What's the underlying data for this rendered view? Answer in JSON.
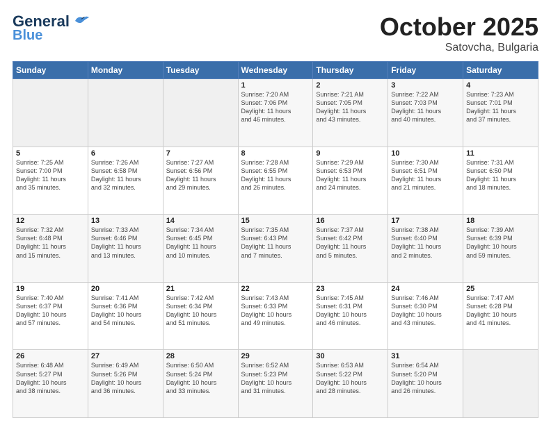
{
  "header": {
    "logo_line1": "General",
    "logo_line2": "Blue",
    "month": "October 2025",
    "location": "Satovcha, Bulgaria"
  },
  "weekdays": [
    "Sunday",
    "Monday",
    "Tuesday",
    "Wednesday",
    "Thursday",
    "Friday",
    "Saturday"
  ],
  "weeks": [
    [
      {
        "day": "",
        "info": ""
      },
      {
        "day": "",
        "info": ""
      },
      {
        "day": "",
        "info": ""
      },
      {
        "day": "1",
        "info": "Sunrise: 7:20 AM\nSunset: 7:06 PM\nDaylight: 11 hours\nand 46 minutes."
      },
      {
        "day": "2",
        "info": "Sunrise: 7:21 AM\nSunset: 7:05 PM\nDaylight: 11 hours\nand 43 minutes."
      },
      {
        "day": "3",
        "info": "Sunrise: 7:22 AM\nSunset: 7:03 PM\nDaylight: 11 hours\nand 40 minutes."
      },
      {
        "day": "4",
        "info": "Sunrise: 7:23 AM\nSunset: 7:01 PM\nDaylight: 11 hours\nand 37 minutes."
      }
    ],
    [
      {
        "day": "5",
        "info": "Sunrise: 7:25 AM\nSunset: 7:00 PM\nDaylight: 11 hours\nand 35 minutes."
      },
      {
        "day": "6",
        "info": "Sunrise: 7:26 AM\nSunset: 6:58 PM\nDaylight: 11 hours\nand 32 minutes."
      },
      {
        "day": "7",
        "info": "Sunrise: 7:27 AM\nSunset: 6:56 PM\nDaylight: 11 hours\nand 29 minutes."
      },
      {
        "day": "8",
        "info": "Sunrise: 7:28 AM\nSunset: 6:55 PM\nDaylight: 11 hours\nand 26 minutes."
      },
      {
        "day": "9",
        "info": "Sunrise: 7:29 AM\nSunset: 6:53 PM\nDaylight: 11 hours\nand 24 minutes."
      },
      {
        "day": "10",
        "info": "Sunrise: 7:30 AM\nSunset: 6:51 PM\nDaylight: 11 hours\nand 21 minutes."
      },
      {
        "day": "11",
        "info": "Sunrise: 7:31 AM\nSunset: 6:50 PM\nDaylight: 11 hours\nand 18 minutes."
      }
    ],
    [
      {
        "day": "12",
        "info": "Sunrise: 7:32 AM\nSunset: 6:48 PM\nDaylight: 11 hours\nand 15 minutes."
      },
      {
        "day": "13",
        "info": "Sunrise: 7:33 AM\nSunset: 6:46 PM\nDaylight: 11 hours\nand 13 minutes."
      },
      {
        "day": "14",
        "info": "Sunrise: 7:34 AM\nSunset: 6:45 PM\nDaylight: 11 hours\nand 10 minutes."
      },
      {
        "day": "15",
        "info": "Sunrise: 7:35 AM\nSunset: 6:43 PM\nDaylight: 11 hours\nand 7 minutes."
      },
      {
        "day": "16",
        "info": "Sunrise: 7:37 AM\nSunset: 6:42 PM\nDaylight: 11 hours\nand 5 minutes."
      },
      {
        "day": "17",
        "info": "Sunrise: 7:38 AM\nSunset: 6:40 PM\nDaylight: 11 hours\nand 2 minutes."
      },
      {
        "day": "18",
        "info": "Sunrise: 7:39 AM\nSunset: 6:39 PM\nDaylight: 10 hours\nand 59 minutes."
      }
    ],
    [
      {
        "day": "19",
        "info": "Sunrise: 7:40 AM\nSunset: 6:37 PM\nDaylight: 10 hours\nand 57 minutes."
      },
      {
        "day": "20",
        "info": "Sunrise: 7:41 AM\nSunset: 6:36 PM\nDaylight: 10 hours\nand 54 minutes."
      },
      {
        "day": "21",
        "info": "Sunrise: 7:42 AM\nSunset: 6:34 PM\nDaylight: 10 hours\nand 51 minutes."
      },
      {
        "day": "22",
        "info": "Sunrise: 7:43 AM\nSunset: 6:33 PM\nDaylight: 10 hours\nand 49 minutes."
      },
      {
        "day": "23",
        "info": "Sunrise: 7:45 AM\nSunset: 6:31 PM\nDaylight: 10 hours\nand 46 minutes."
      },
      {
        "day": "24",
        "info": "Sunrise: 7:46 AM\nSunset: 6:30 PM\nDaylight: 10 hours\nand 43 minutes."
      },
      {
        "day": "25",
        "info": "Sunrise: 7:47 AM\nSunset: 6:28 PM\nDaylight: 10 hours\nand 41 minutes."
      }
    ],
    [
      {
        "day": "26",
        "info": "Sunrise: 6:48 AM\nSunset: 5:27 PM\nDaylight: 10 hours\nand 38 minutes."
      },
      {
        "day": "27",
        "info": "Sunrise: 6:49 AM\nSunset: 5:26 PM\nDaylight: 10 hours\nand 36 minutes."
      },
      {
        "day": "28",
        "info": "Sunrise: 6:50 AM\nSunset: 5:24 PM\nDaylight: 10 hours\nand 33 minutes."
      },
      {
        "day": "29",
        "info": "Sunrise: 6:52 AM\nSunset: 5:23 PM\nDaylight: 10 hours\nand 31 minutes."
      },
      {
        "day": "30",
        "info": "Sunrise: 6:53 AM\nSunset: 5:22 PM\nDaylight: 10 hours\nand 28 minutes."
      },
      {
        "day": "31",
        "info": "Sunrise: 6:54 AM\nSunset: 5:20 PM\nDaylight: 10 hours\nand 26 minutes."
      },
      {
        "day": "",
        "info": ""
      }
    ]
  ]
}
